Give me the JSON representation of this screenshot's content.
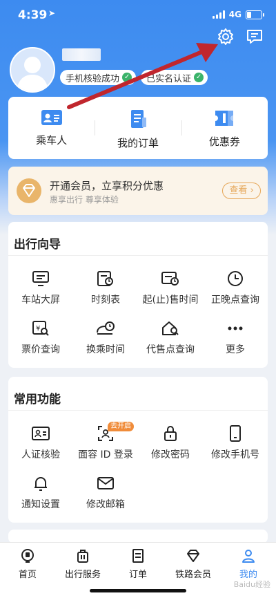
{
  "status": {
    "time": "4:39",
    "network": "4G"
  },
  "profile": {
    "badges": [
      "手机核验成功",
      "已实名认证"
    ]
  },
  "quick_actions": [
    {
      "label": "乘车人",
      "icon": "passenger-card-icon"
    },
    {
      "label": "我的订单",
      "icon": "order-doc-icon"
    },
    {
      "label": "优惠券",
      "icon": "coupon-icon"
    }
  ],
  "member": {
    "title": "开通会员，立享积分优惠",
    "subtitle": "惠享出行 尊享体验",
    "button": "查看"
  },
  "travel_guide": {
    "title": "出行向导",
    "items": [
      {
        "label": "车站大屏",
        "icon": "station-screen-icon"
      },
      {
        "label": "时刻表",
        "icon": "timetable-icon"
      },
      {
        "label": "起(止)售时间",
        "icon": "sale-time-icon"
      },
      {
        "label": "正晚点查询",
        "icon": "clock-icon"
      },
      {
        "label": "票价查询",
        "icon": "fare-query-icon"
      },
      {
        "label": "换乘时间",
        "icon": "transfer-time-icon"
      },
      {
        "label": "代售点查询",
        "icon": "agency-search-icon"
      },
      {
        "label": "更多",
        "icon": "more-dots-icon"
      }
    ]
  },
  "common_functions": {
    "title": "常用功能",
    "items": [
      {
        "label": "人证核验",
        "icon": "id-card-icon"
      },
      {
        "label": "面容 ID 登录",
        "icon": "face-id-icon",
        "tag": "去开启"
      },
      {
        "label": "修改密码",
        "icon": "lock-icon"
      },
      {
        "label": "修改手机号",
        "icon": "phone-icon"
      },
      {
        "label": "通知设置",
        "icon": "bell-icon"
      },
      {
        "label": "修改邮箱",
        "icon": "mail-icon"
      }
    ]
  },
  "tabbar": [
    {
      "label": "首页",
      "icon": "home-train-icon"
    },
    {
      "label": "出行服务",
      "icon": "luggage-icon"
    },
    {
      "label": "订单",
      "icon": "order-list-icon"
    },
    {
      "label": "铁路会员",
      "icon": "diamond-icon"
    },
    {
      "label": "我的",
      "icon": "person-icon",
      "active": true
    }
  ],
  "watermark": "Baidu经验",
  "colors": {
    "primary": "#3d8bf0",
    "arrow": "#c0262d",
    "member_accent": "#e6a657",
    "tag_orange": "#f08c3a",
    "verify_green": "#3bb36a"
  }
}
